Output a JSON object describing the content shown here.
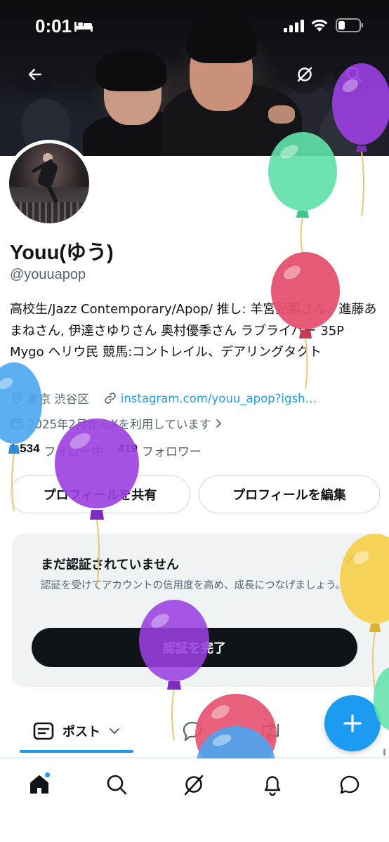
{
  "status_bar": {
    "time": "0:01"
  },
  "profile": {
    "display_name": "Youu(ゆう)",
    "handle": "@youuapop",
    "bio": "高校生/Jazz Contemporary/Apop/ 推し: 羊宮妃那さん、進藤あまねさん, 伊達さゆりさん 奥村優季さん ラブライバー 35P Mygo ヘリウ民 競馬:コントレイル、デアリングタクト",
    "location": "東京 渋谷区",
    "link": "instagram.com/youu_apop?igsh…",
    "joined": "2025年2月からXを利用しています",
    "following_count": "1,534",
    "following_label": "フォロー中",
    "followers_count": "419",
    "followers_label": "フォロワー"
  },
  "buttons": {
    "share_profile": "プロフィールを共有",
    "edit_profile": "プロフィールを編集"
  },
  "verification": {
    "title": "まだ認証されていません",
    "description": "認証を受けてアカウントの信用度を高め、成長につなげましょう。",
    "close": "×",
    "cta": "認証を完了"
  },
  "tabs": {
    "active_label": "ポスト"
  },
  "colors": {
    "accent": "#1d9bf0",
    "balloon_purple": "#9b3fe0",
    "balloon_green": "#5fe0a8",
    "balloon_red": "#e5506e",
    "balloon_blue": "#4aa6f2",
    "balloon_yellow": "#f5cf4a"
  },
  "icons": [
    "bed-icon",
    "signal-icon",
    "wifi-icon",
    "battery-icon",
    "back-arrow-icon",
    "grok-icon",
    "search-icon",
    "location-pin-icon",
    "link-icon",
    "calendar-icon",
    "chevron-right-icon",
    "posts-tab-icon",
    "chevron-down-icon",
    "reply-icon",
    "repost-icon",
    "compose-plus-icon",
    "home-icon",
    "explore-search-icon",
    "grok-nav-icon",
    "notifications-bell-icon",
    "messages-icon"
  ]
}
